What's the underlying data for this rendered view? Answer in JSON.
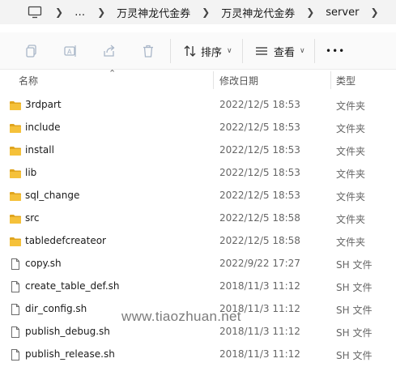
{
  "breadcrumb": {
    "more": "…",
    "items": [
      "万灵神龙代金券",
      "万灵神龙代金券",
      "server"
    ]
  },
  "toolbar": {
    "icons": [
      "copy-icon",
      "rename-icon",
      "share-icon",
      "delete-icon"
    ],
    "sort_label": "排序",
    "view_label": "查看",
    "more_label": "•••"
  },
  "columns": {
    "name": "名称",
    "date": "修改日期",
    "type": "类型"
  },
  "files": [
    {
      "name": "3rdpart",
      "date": "2022/12/5 18:53",
      "type": "文件夹",
      "kind": "folder"
    },
    {
      "name": "include",
      "date": "2022/12/5 18:53",
      "type": "文件夹",
      "kind": "folder"
    },
    {
      "name": "install",
      "date": "2022/12/5 18:53",
      "type": "文件夹",
      "kind": "folder"
    },
    {
      "name": "lib",
      "date": "2022/12/5 18:53",
      "type": "文件夹",
      "kind": "folder"
    },
    {
      "name": "sql_change",
      "date": "2022/12/5 18:53",
      "type": "文件夹",
      "kind": "folder"
    },
    {
      "name": "src",
      "date": "2022/12/5 18:58",
      "type": "文件夹",
      "kind": "folder"
    },
    {
      "name": "tabledefcreateor",
      "date": "2022/12/5 18:58",
      "type": "文件夹",
      "kind": "folder"
    },
    {
      "name": "copy.sh",
      "date": "2022/9/22 17:27",
      "type": "SH 文件",
      "kind": "file"
    },
    {
      "name": "create_table_def.sh",
      "date": "2018/11/3 11:12",
      "type": "SH 文件",
      "kind": "file"
    },
    {
      "name": "dir_config.sh",
      "date": "2018/11/3 11:12",
      "type": "SH 文件",
      "kind": "file"
    },
    {
      "name": "publish_debug.sh",
      "date": "2018/11/3 11:12",
      "type": "SH 文件",
      "kind": "file"
    },
    {
      "name": "publish_release.sh",
      "date": "2018/11/3 11:12",
      "type": "SH 文件",
      "kind": "file"
    }
  ],
  "watermark": "www.tiaozhuan.net",
  "colors": {
    "folder": "#f5c13a",
    "folder_dark": "#e0a51e",
    "file_outline": "#6b6b6b",
    "toolbar_icon_disabled": "#a9b6c8"
  }
}
